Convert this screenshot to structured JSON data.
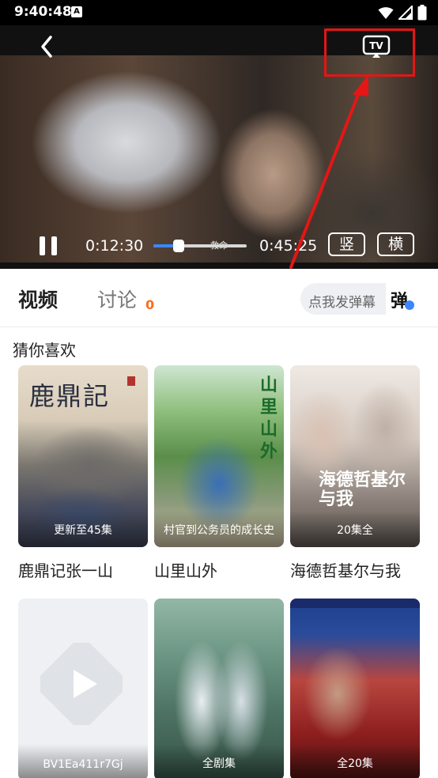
{
  "status_bar": {
    "time": "9:40:48",
    "a_badge": "A"
  },
  "player": {
    "subtitle": "救命",
    "current_time": "0:12:30",
    "duration": "0:45:25",
    "progress": 0.2752,
    "portrait_label": "竖",
    "landscape_label": "横",
    "tv_label": "TV"
  },
  "tabs": {
    "video": "视频",
    "discuss": "讨论",
    "discuss_count": "0",
    "danmu_button": "点我发弹幕",
    "danmu_badge": "弹"
  },
  "section": {
    "title": "猜你喜欢"
  },
  "cards": [
    {
      "title": "鹿鼎记张一山",
      "badge": "更新至45集",
      "poster_text": "鹿鼎記"
    },
    {
      "title": "山里山外",
      "badge": "村官到公务员的成长史",
      "poster_text": "山里山外"
    },
    {
      "title": "海德哲基尔与我",
      "badge": "20集全",
      "poster_text": "海德哲基尔与我"
    },
    {
      "title": "",
      "badge": "BV1Ea411r7Gj",
      "poster_text": ""
    },
    {
      "title": "",
      "badge": "全剧集",
      "poster_text": ""
    },
    {
      "title": "",
      "badge": "全20集",
      "poster_text": ""
    }
  ],
  "colors": {
    "accent": "#3a86ff",
    "highlight_red": "#e41616",
    "count_orange": "#ff6b1a"
  }
}
